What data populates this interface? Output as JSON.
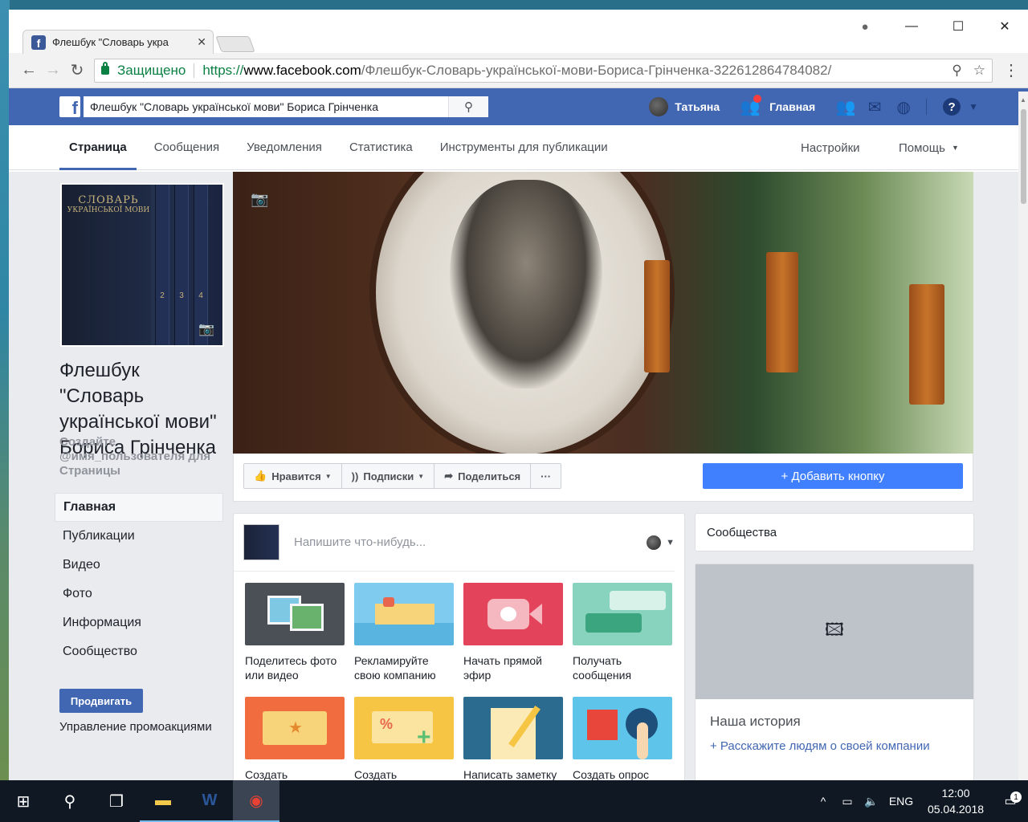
{
  "browser": {
    "tab_title": "Флешбук \"Словарь укра",
    "tab_favicon": "f",
    "secure_label": "Защищено",
    "url_proto": "https://",
    "url_host": "www.facebook.com",
    "url_path": "/Флешбук-Словарь-української-мови-Бориса-Грінченка-322612864784082/"
  },
  "fb": {
    "search_value": "Флешбук \"Словарь української мови\" Бориса Грінченка",
    "user_name": "Татьяна",
    "home_label": "Главная",
    "help_glyph": "?",
    "logo_glyph": "f",
    "brand_color": "#4267b2"
  },
  "pagetabs": {
    "items": [
      "Страница",
      "Сообщения",
      "Уведомления",
      "Статистика",
      "Инструменты для публикации"
    ],
    "settings": "Настройки",
    "help": "Помощь"
  },
  "page": {
    "name": "Флешбук \"Словарь української мови\" Бориса Грінченка",
    "username_prompt": "Создайте @имя_пользователя для Страницы",
    "book_title": "СЛОВАРЬ",
    "book_subtitle": "УКРАЇНСЬКОЇ МОВИ",
    "spines": [
      "2",
      "3",
      "4"
    ],
    "nav": [
      "Главная",
      "Публикации",
      "Видео",
      "Фото",
      "Информация",
      "Сообщество"
    ],
    "promote_button": "Продвигать",
    "promo_link": "Управление промоакциями"
  },
  "actions": {
    "like": "Нравится",
    "follow": "Подписки",
    "share": "Поделиться",
    "more": "···",
    "add_button": "+ Добавить кнопку"
  },
  "composer": {
    "placeholder": "Напишите что-нибудь...",
    "tiles": [
      {
        "label": "Поделитесь фото или видео",
        "icon": "photo-video-icon"
      },
      {
        "label": "Рекламируйте свою компанию",
        "icon": "store-icon"
      },
      {
        "label": "Начать прямой эфир",
        "icon": "live-video-icon"
      },
      {
        "label": "Получать сообщения",
        "icon": "messages-icon"
      },
      {
        "label": "Создать мероприятие",
        "icon": "ticket-icon"
      },
      {
        "label": "Создать предложение",
        "icon": "offer-icon"
      },
      {
        "label": "Написать заметку",
        "icon": "note-icon"
      },
      {
        "label": "Создать опрос",
        "icon": "poll-icon"
      }
    ]
  },
  "right": {
    "community": "Сообщества",
    "story_title": "Наша история",
    "story_link": "+ Расскажите людям о своей компании"
  },
  "taskbar": {
    "lang": "ENG",
    "time": "12:00",
    "date": "05.04.2018",
    "notif_count": "1"
  }
}
